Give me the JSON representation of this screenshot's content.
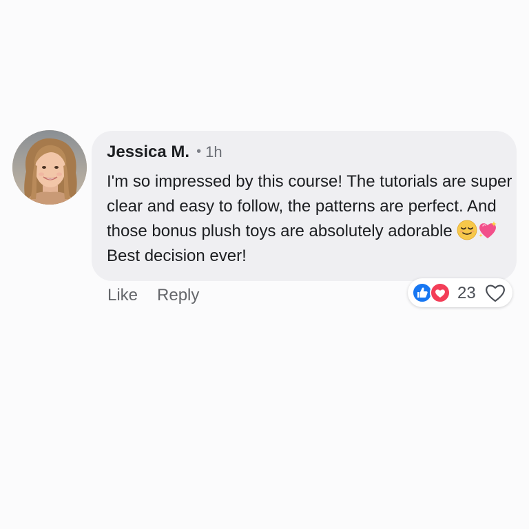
{
  "comment": {
    "author": "Jessica M.",
    "separator": "•",
    "time": "1h",
    "text_part1": "I'm so impressed by this course! The tutorials are super clear and easy to follow, the patterns are perfect. And those bonus plush toys are absolutely adorable",
    "text_part2": "Best decision ever!",
    "emojis": [
      "relieved-face-emoji",
      "sparkling-heart-emoji"
    ]
  },
  "actions": {
    "like_label": "Like",
    "reply_label": "Reply"
  },
  "reactions": {
    "types": [
      "like-icon",
      "love-icon"
    ],
    "count": "23"
  },
  "colors": {
    "bubble": "#efeff2",
    "like_blue": "#1877f2",
    "love_red": "#f33e58",
    "muted_text": "#65676b"
  }
}
